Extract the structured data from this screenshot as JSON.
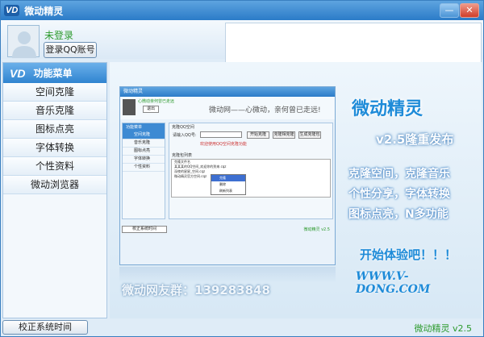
{
  "window": {
    "logo": "VD",
    "title": "微动精灵",
    "minimize": "—",
    "close": "✕"
  },
  "user": {
    "status": "未登录",
    "login_button": "登录QQ账号"
  },
  "sidebar": {
    "logo": "VD",
    "header": "功能菜单",
    "items": [
      {
        "label": "空间克隆"
      },
      {
        "label": "音乐克隆"
      },
      {
        "label": "图标点亮"
      },
      {
        "label": "字体转换"
      },
      {
        "label": "个性资料"
      },
      {
        "label": "微动浏览器"
      }
    ]
  },
  "promo": {
    "brand": "微动精灵",
    "release": "v2.5隆重发布",
    "features": [
      "克隆空间，克隆音乐",
      "个性分享，字体转换",
      "图标点亮，N多功能"
    ],
    "cta": "开始体验吧！！！",
    "url": "WWW.V-DONG.COM",
    "qq_group": "微动网友群：139283848"
  },
  "preview": {
    "title": "微动精灵",
    "user": "心微动亲何曾已走远",
    "login": "退出",
    "slogan": "微动网——心微动，亲何曾已走远!",
    "menu_header": "功能菜单",
    "menu_items": [
      "空间克隆",
      "音乐克隆",
      "图标点亮",
      "字体转换",
      "个性资料"
    ],
    "section": "克隆QQ空间",
    "input_label": "请输入QQ号:",
    "buttons": [
      "开始克隆",
      "克隆相克隆",
      "生成克隆包"
    ],
    "hint": "欢迎使用QQ空间克隆功能",
    "list_header": "克隆包列表",
    "rows": [
      "克隆文件名",
      "某某某的QQ空间_欢迎你的到来.cqz",
      "深夜的星星_空间.cqz",
      "微动精灵官方空间.cqz"
    ],
    "context_menu": [
      "克隆",
      "删除",
      "刷新列表"
    ],
    "bottom_button": "校正系统时间",
    "version": "微动精灵 v2.5"
  },
  "footer": {
    "time_button": "校正系统时间",
    "version": "微动精灵 v2.5"
  }
}
